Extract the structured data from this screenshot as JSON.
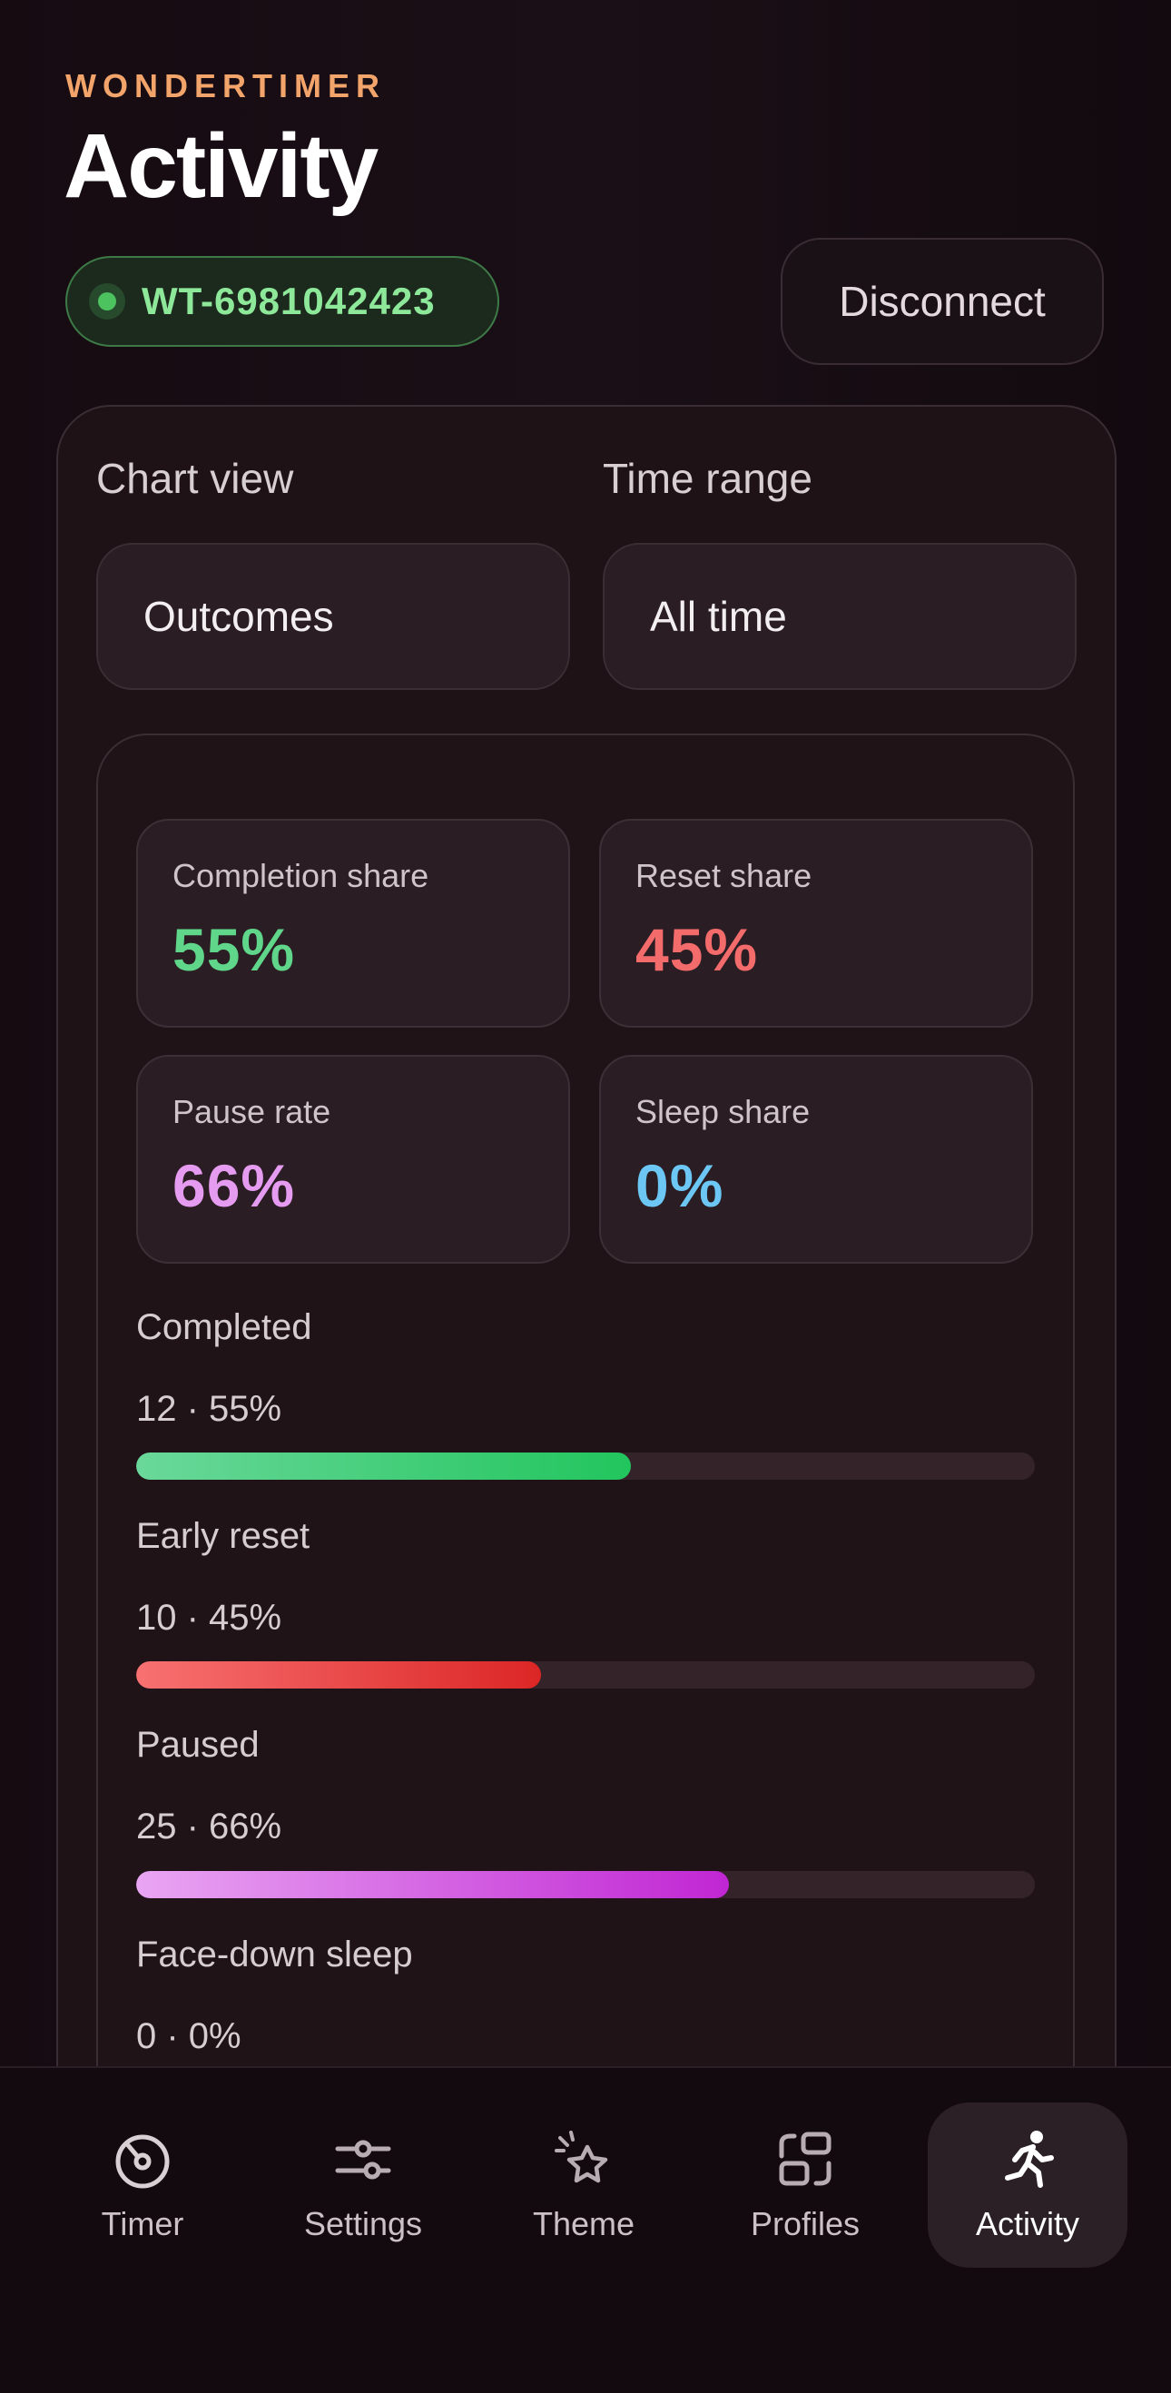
{
  "header": {
    "brand": "WONDERTIMER",
    "title": "Activity",
    "device_id": "WT-6981042423",
    "disconnect_label": "Disconnect"
  },
  "filters": {
    "chart_view_label": "Chart view",
    "chart_view_value": "Outcomes",
    "time_range_label": "Time range",
    "time_range_value": "All time"
  },
  "stats": [
    {
      "label": "Completion share",
      "value": "55%",
      "color": "#5fd68a"
    },
    {
      "label": "Reset share",
      "value": "45%",
      "color": "#f46b6b"
    },
    {
      "label": "Pause rate",
      "value": "66%",
      "color": "#e59cf0"
    },
    {
      "label": "Sleep share",
      "value": "0%",
      "color": "#6cc7f5"
    }
  ],
  "metrics": [
    {
      "label": "Completed",
      "value": "12 · 55%",
      "fraction": 0.55,
      "color_start": "#6ad89a",
      "color_end": "#22c55e"
    },
    {
      "label": "Early reset",
      "value": "10 · 45%",
      "fraction": 0.45,
      "color_start": "#f87171",
      "color_end": "#dc2626"
    },
    {
      "label": "Paused",
      "value": "25 · 66%",
      "fraction": 0.66,
      "color_start": "#e9a6f3",
      "color_end": "#c026d3"
    },
    {
      "label": "Face-down sleep",
      "value": "0 · 0%",
      "fraction": 0.0,
      "color_start": "#7dd3fc",
      "color_end": "#0ea5e9"
    }
  ],
  "nav": {
    "items": [
      {
        "label": "Timer",
        "icon": "timer-icon",
        "active": false
      },
      {
        "label": "Settings",
        "icon": "sliders-icon",
        "active": false
      },
      {
        "label": "Theme",
        "icon": "sparkle-star-icon",
        "active": false
      },
      {
        "label": "Profiles",
        "icon": "profiles-icon",
        "active": false
      },
      {
        "label": "Activity",
        "icon": "running-icon",
        "active": true
      }
    ]
  },
  "colors": {
    "accent_orange": "#f2a46a",
    "connected_green": "#8ee89a"
  }
}
